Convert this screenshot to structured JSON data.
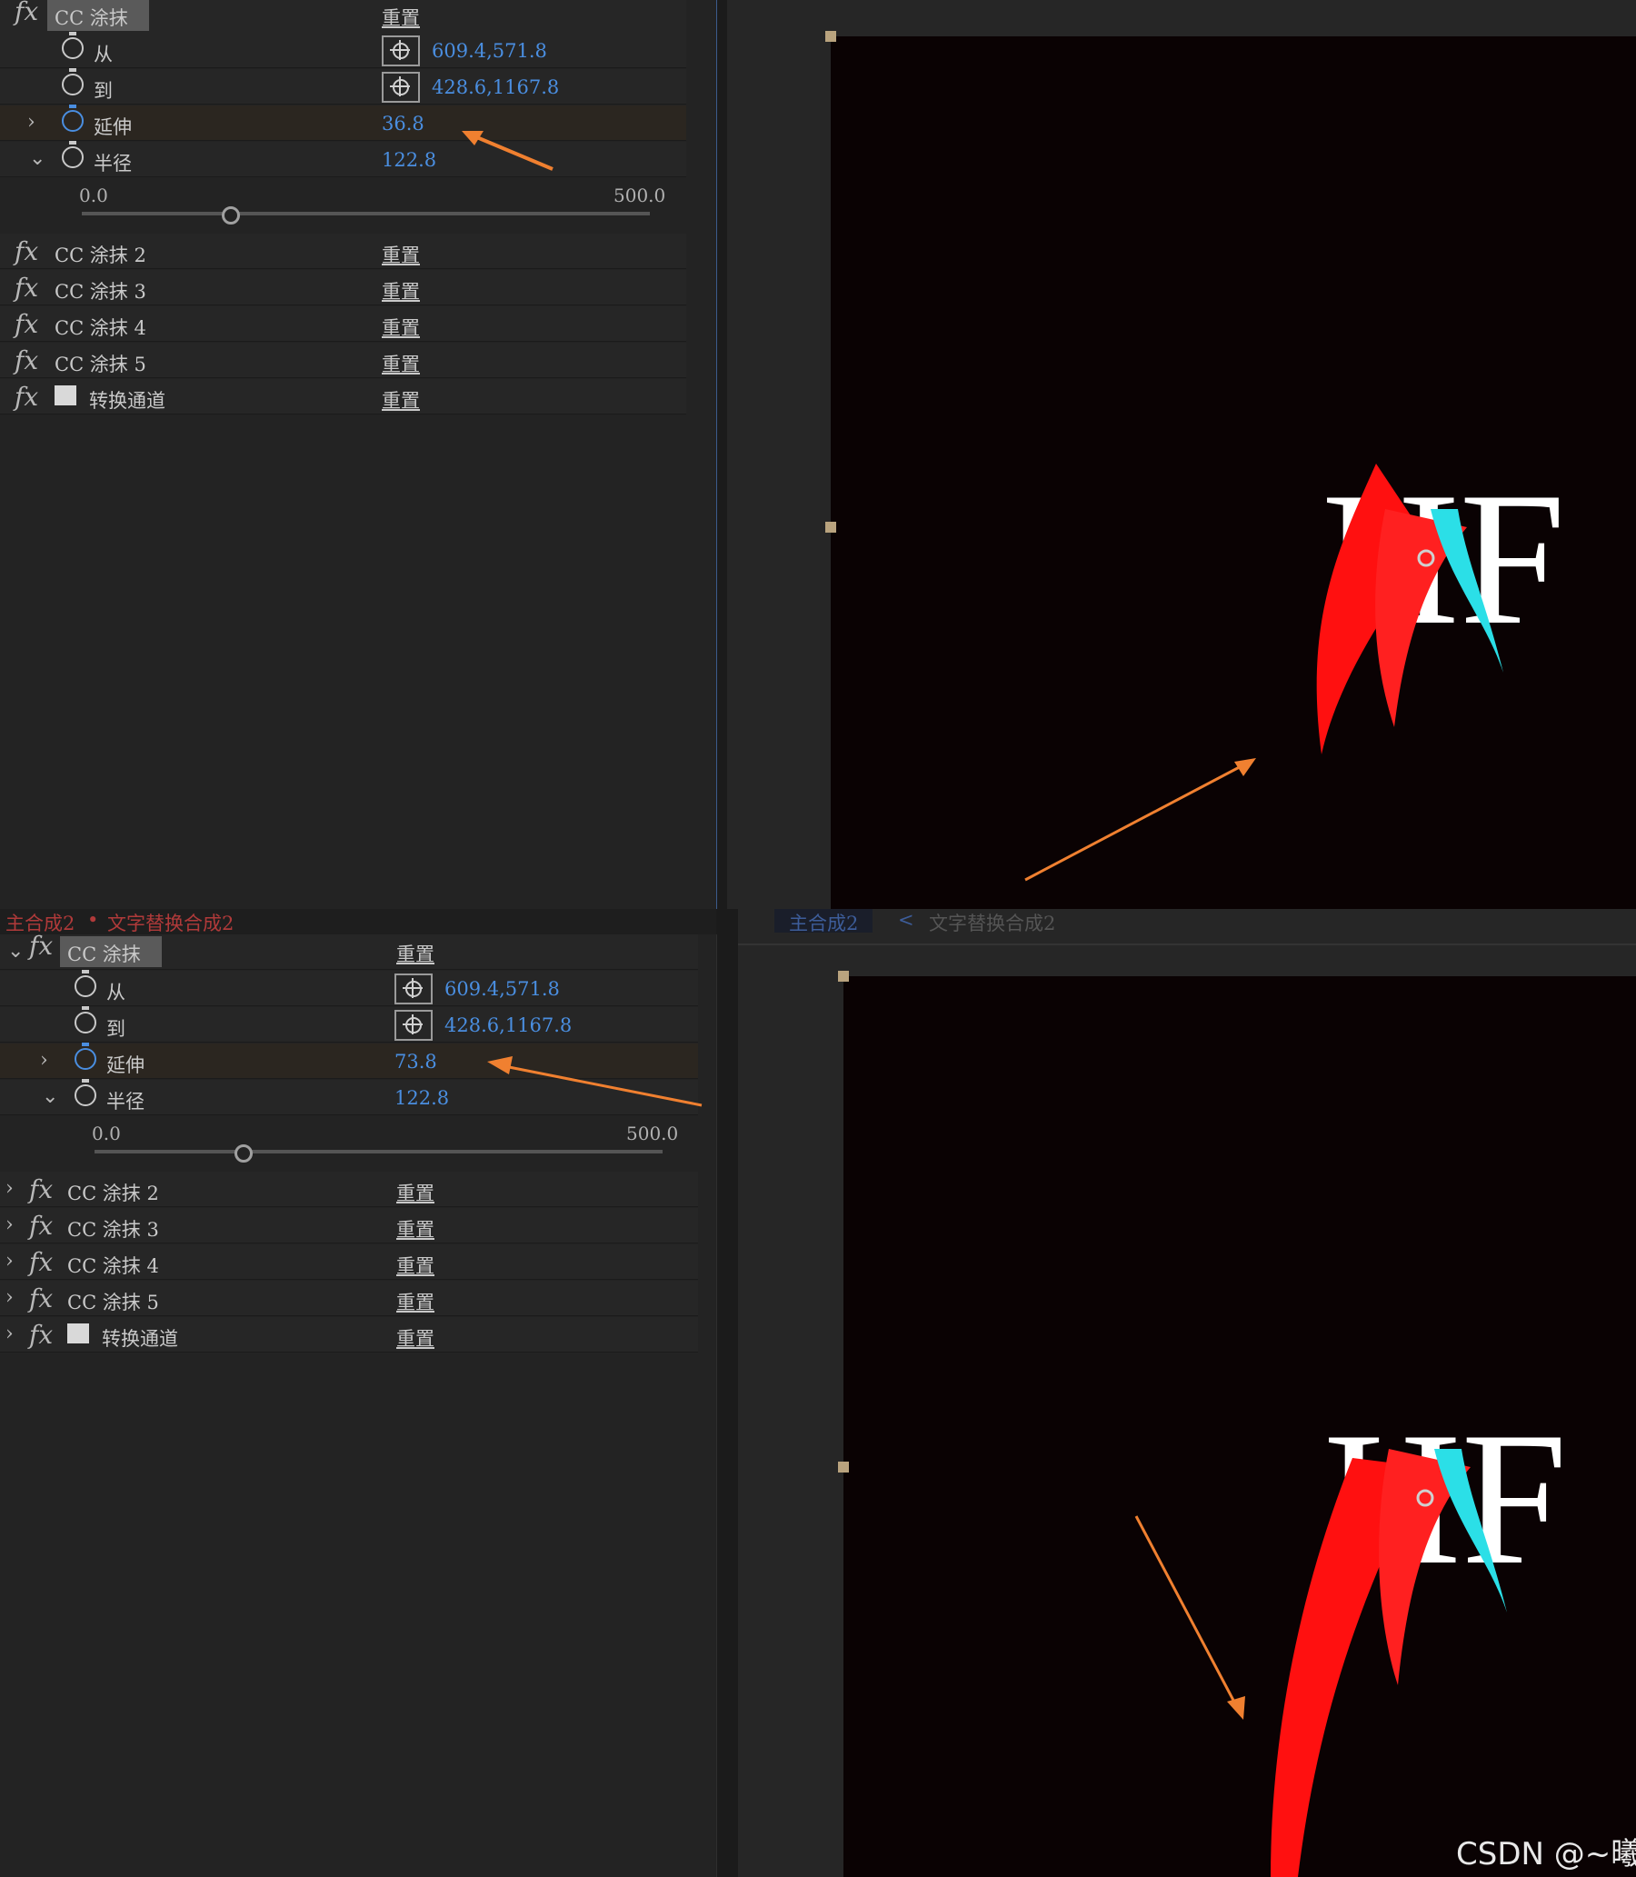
{
  "top": {
    "effects": {
      "main": {
        "name": "CC 涂抹",
        "reset": "重置"
      },
      "props": [
        {
          "label": "从",
          "value": "609.4,571.8"
        },
        {
          "label": "到",
          "value": "428.6,1167.8"
        },
        {
          "label": "延伸",
          "value": "36.8"
        },
        {
          "label": "半径",
          "value": "122.8"
        }
      ],
      "slider": {
        "min": "0.0",
        "max": "500.0",
        "position": 0.25
      },
      "others": [
        {
          "name": "CC 涂抹 2",
          "reset": "重置"
        },
        {
          "name": "CC 涂抹 3",
          "reset": "重置"
        },
        {
          "name": "CC 涂抹 4",
          "reset": "重置"
        },
        {
          "name": "CC 涂抹 5",
          "reset": "重置"
        },
        {
          "name": "转换通道",
          "reset": "重置"
        }
      ]
    }
  },
  "bottom": {
    "breadcrumb": {
      "comp": "主合成2",
      "sep": "•",
      "layer": "文字替换合成2"
    },
    "viewer_tabs": {
      "comp": "主合成2",
      "arrow": "<",
      "sub": "文字替换合成2"
    },
    "effects": {
      "main": {
        "name": "CC 涂抹",
        "reset": "重置"
      },
      "props": [
        {
          "label": "从",
          "value": "609.4,571.8"
        },
        {
          "label": "到",
          "value": "428.6,1167.8"
        },
        {
          "label": "延伸",
          "value": "73.8"
        },
        {
          "label": "半径",
          "value": "122.8"
        }
      ],
      "slider": {
        "min": "0.0",
        "max": "500.0",
        "position": 0.25
      },
      "others": [
        {
          "name": "CC 涂抹 2",
          "reset": "重置"
        },
        {
          "name": "CC 涂抹 3",
          "reset": "重置"
        },
        {
          "name": "CC 涂抹 4",
          "reset": "重置"
        },
        {
          "name": "CC 涂抹 5",
          "reset": "重置"
        },
        {
          "name": "转换通道",
          "reset": "重置"
        }
      ]
    }
  },
  "canvas_text": "HF",
  "watermark": "CSDN @~曦",
  "colors": {
    "accent": "#4a8ee0",
    "arrow": "#f08030",
    "canvas_bg": "#0a0203",
    "handle": "#b9a37e"
  }
}
